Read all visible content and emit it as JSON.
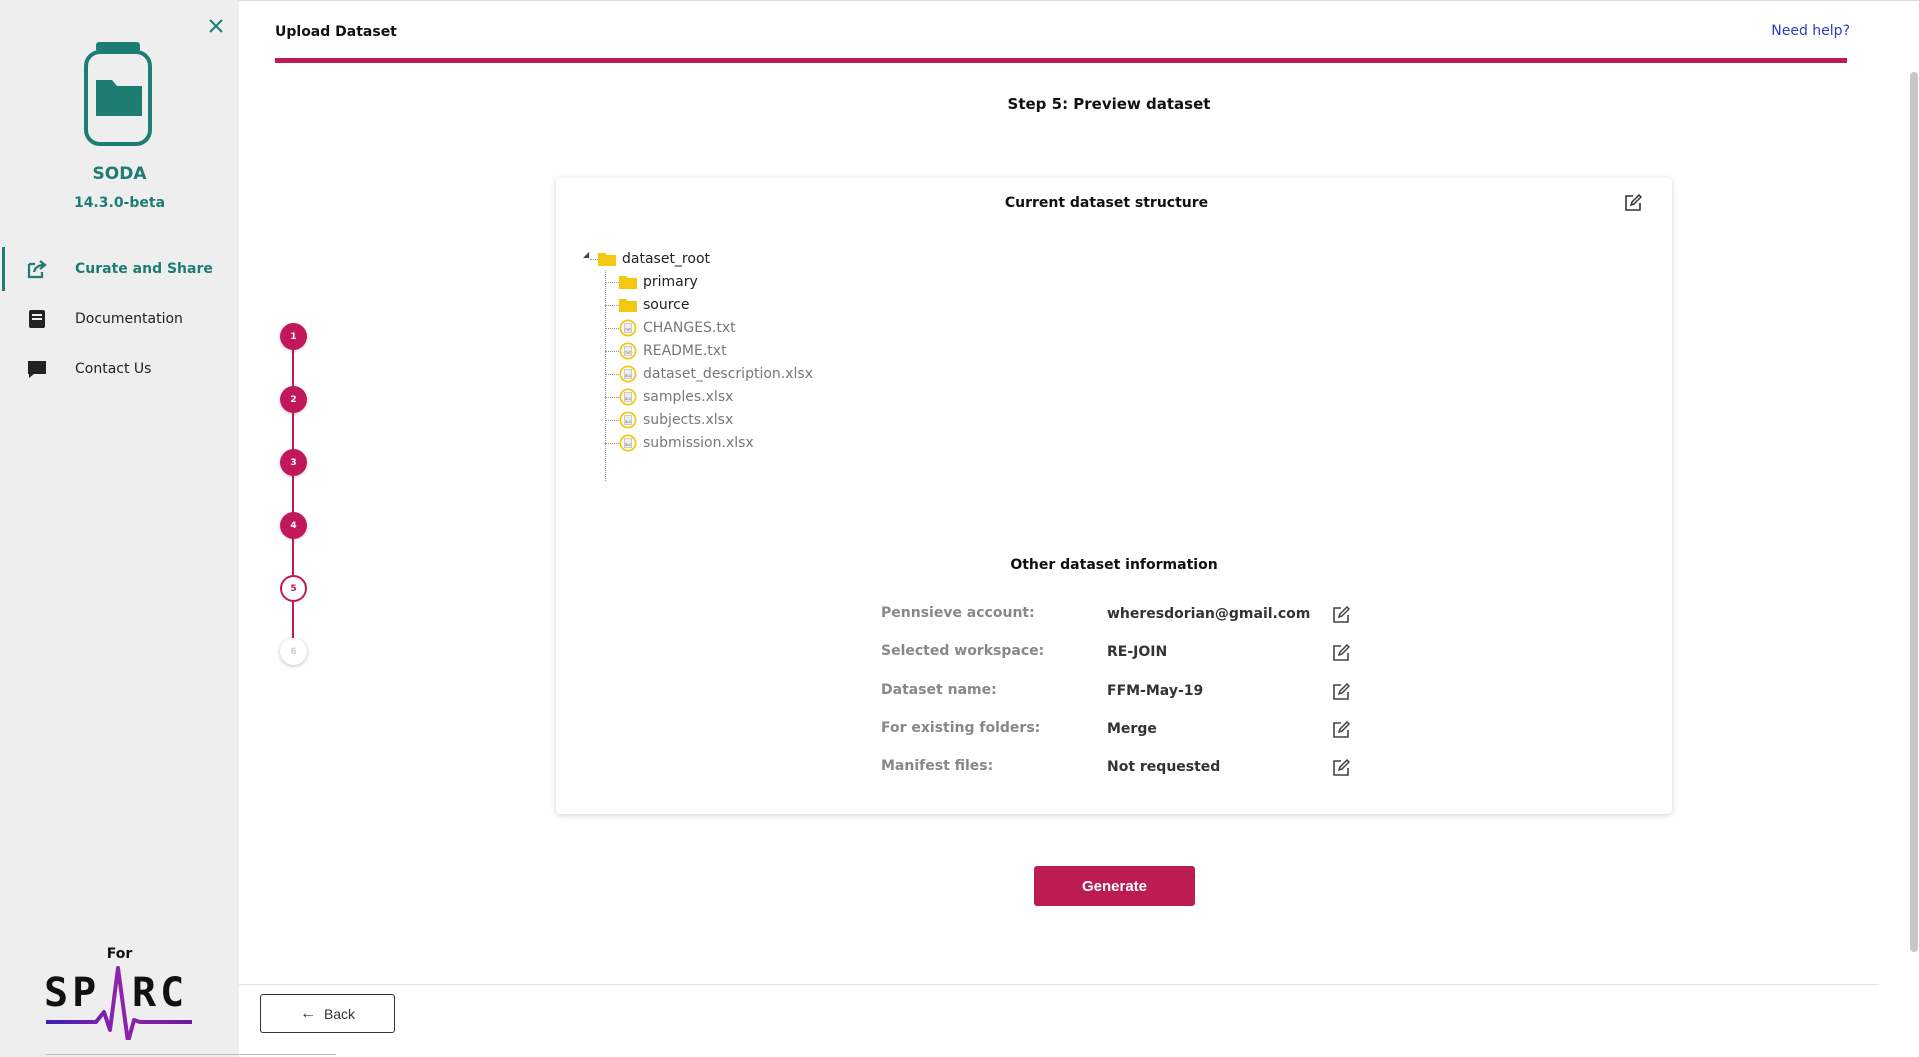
{
  "sidebar": {
    "app_name": "SODA",
    "version": "14.3.0-beta",
    "nav": [
      {
        "label": "Curate and Share",
        "icon": "share-icon",
        "active": true
      },
      {
        "label": "Documentation",
        "icon": "book-icon",
        "active": false
      },
      {
        "label": "Contact Us",
        "icon": "chat-icon",
        "active": false
      }
    ],
    "footer_for": "For",
    "footer_logo_text": "SPARC"
  },
  "header": {
    "title": "Upload Dataset",
    "help_link": "Need help?"
  },
  "step_title": "Step 5: Preview dataset",
  "stepper": [
    "1",
    "2",
    "3",
    "4",
    "5",
    "6"
  ],
  "stepper_current": 5,
  "structure": {
    "title": "Current dataset structure",
    "root": "dataset_root",
    "folders": [
      "primary",
      "source"
    ],
    "files": [
      "CHANGES.txt",
      "README.txt",
      "dataset_description.xlsx",
      "samples.xlsx",
      "subjects.xlsx",
      "submission.xlsx"
    ]
  },
  "info": {
    "title": "Other dataset information",
    "rows": [
      {
        "label": "Pennsieve account:",
        "value": "wheresdorian@gmail.com"
      },
      {
        "label": "Selected workspace:",
        "value": "RE-JOIN"
      },
      {
        "label": "Dataset name:",
        "value": "FFM-May-19"
      },
      {
        "label": "For existing folders:",
        "value": "Merge"
      },
      {
        "label": "Manifest files:",
        "value": "Not requested"
      }
    ]
  },
  "buttons": {
    "generate": "Generate",
    "back": "Back"
  },
  "colors": {
    "brand_teal": "#1e7d73",
    "accent_red": "#bc1c52",
    "folder_yellow": "#f2c811"
  }
}
